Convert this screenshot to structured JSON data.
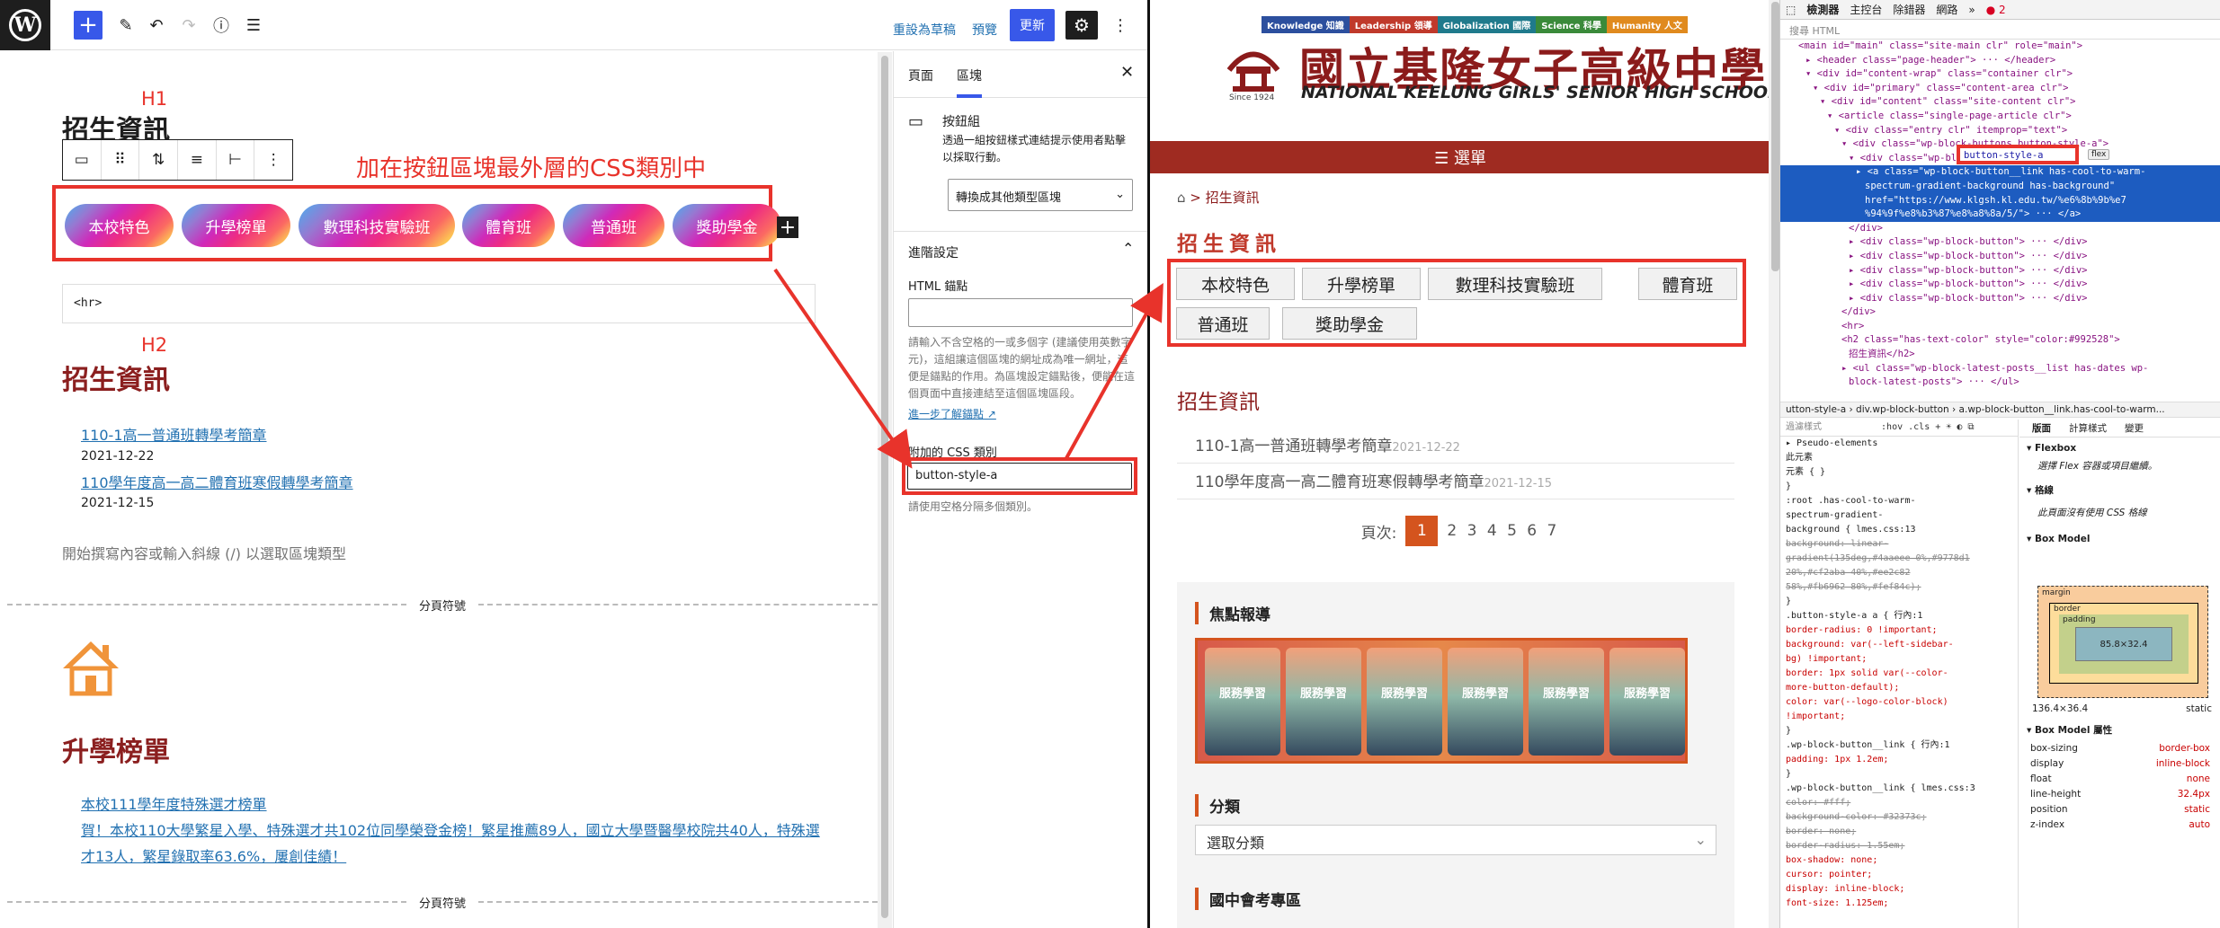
{
  "editor": {
    "topbar": {
      "save_draft": "重設為草稿",
      "preview": "預覽",
      "update": "更新"
    },
    "annotations": {
      "h1": "H1",
      "h2": "H2",
      "note": "加在按鈕區塊最外層的CSS類別中"
    },
    "content": {
      "heading1": "招生資訊",
      "buttons": [
        "本校特色",
        "升學榜單",
        "數理科技實驗班",
        "體育班",
        "普通班",
        "獎助學金"
      ],
      "hr_block": "<hr>",
      "heading2": "招生資訊",
      "posts": [
        {
          "title": "110-1高一普通班轉學考簡章",
          "date": "2021-12-22"
        },
        {
          "title": "110學年度高一高二體育班寒假轉學考簡章",
          "date": "2021-12-15"
        }
      ],
      "placeholder": "開始撰寫內容或輸入斜線 (/) 以選取區塊類型",
      "page_break": "分頁符號",
      "heading3": "升學榜單",
      "posts2": [
        {
          "title": "本校111學年度特殊選才榜單"
        },
        {
          "title": "賀！本校110大學繁星入學、特殊選才共102位同學榮登金榜！繁星推薦89人，國立大學暨醫學校院共40人，特殊選"
        },
        {
          "title": "才13人，繁星錄取率63.6%，屢創佳績！"
        }
      ]
    },
    "sidebar": {
      "tabs": [
        "頁面",
        "區塊"
      ],
      "block_name": "按鈕組",
      "block_desc": "透過一組按鈕樣式連結提示使用者點擊以採取行動。",
      "transform": "轉換成其他類型區塊",
      "advanced": "進階設定",
      "anchor_label": "HTML 錨點",
      "anchor_help": "請輸入不含空格的一或多個字 (建議使用英數字元)，這組讓這個區塊的網址成為唯一網址，這便是錨點的作用。為區塊設定錨點後，便能在這個頁面中直接連結至這個區塊區段。",
      "anchor_link": "進一步了解錨點",
      "css_label": "附加的 CSS 類別",
      "css_value": "button-style-a",
      "css_help": "請使用空格分隔多個類別。"
    }
  },
  "site": {
    "tags": [
      {
        "label": "Knowledge 知識",
        "color": "#2c4f9e"
      },
      {
        "label": "Leadership 領導",
        "color": "#c0392b"
      },
      {
        "label": "Globalization 國際",
        "color": "#1f7a8c"
      },
      {
        "label": "Science 科學",
        "color": "#3a8a3a"
      },
      {
        "label": "Humanity 人文",
        "color": "#e08a1e"
      }
    ],
    "school_name": "國立基隆女子高級中學",
    "school_en": "NATIONAL KEELUNG GIRLS' SENIOR HIGH SCHOOL",
    "since": "Since 1924",
    "menu": "☰ 選單",
    "breadcrumb_current": "招生資訊",
    "title": "招生資訊",
    "buttons": [
      "本校特色",
      "升學榜單",
      "數理科技實驗班",
      "體育班",
      "普通班",
      "獎助學金"
    ],
    "section_title": "招生資訊",
    "posts": [
      {
        "title": "110-1高一普通班轉學考簡章",
        "date": "2021-12-22"
      },
      {
        "title": "110學年度高一高二體育班寒假轉學考簡章",
        "date": "2021-12-15"
      }
    ],
    "pager_label": "頁次:",
    "pager_current": "1",
    "pager_pages": "2 3 4 5 6 7",
    "focus_title": "焦點報導",
    "banner_text": "服務學習",
    "category_title": "分類",
    "category_select": "選取分類",
    "exam_title": "國中會考專區"
  },
  "devtools": {
    "tabs": [
      "檢測器",
      "主控台",
      "除錯器",
      "網路"
    ],
    "filter": "搜尋 HTML",
    "highlight_class": "button-style-a",
    "badge": "flex",
    "errors": "2",
    "dom": [
      "<main id=\"main\" class=\"site-main clr\" role=\"main\">",
      "▸ <header class=\"page-header\"> ··· </header>",
      "▾ <div id=\"content-wrap\" class=\"container clr\">",
      "▾ <div id=\"primary\" class=\"content-area clr\">",
      "▾ <div id=\"content\" class=\"site-content clr\">",
      "▾ <article class=\"single-page-article clr\">",
      "▾ <div class=\"entry clr\" itemprop=\"text\">",
      "▾ <div class=\"wp-block-buttons button-style-a\">",
      "▾ <div class=\"wp-block-button\">",
      "▸ <a class=\"wp-block-button__link has-cool-to-warm-",
      "spectrum-gradient-background has-background\"",
      "href=\"https://www.klgsh.kl.edu.tw/%e6%8b%9b%e7",
      "%94%9f%e8%b3%87%e8%a8%8a/5/\"> ··· </a>",
      "</div>",
      "▸ <div class=\"wp-block-button\"> ··· </div>",
      "▸ <div class=\"wp-block-button\"> ··· </div>",
      "▸ <div class=\"wp-block-button\"> ··· </div>",
      "▸ <div class=\"wp-block-button\"> ··· </div>",
      "▸ <div class=\"wp-block-button\"> ··· </div>",
      "</div>",
      "<hr>",
      "<h2 class=\"has-text-color\" style=\"color:#992528\">",
      "招生資訊</h2>",
      "▸ <ul class=\"wp-block-latest-posts__list has-dates wp-",
      "block-latest-posts\"> ··· </ul>"
    ],
    "breadcrumb": "utton-style-a  ›  div.wp-block-button  ›  a.wp-block-button__link.has-cool-to-warm...",
    "styles_filter": "過濾樣式",
    "styles": [
      "▸ Pseudo-elements",
      "此元素",
      "元素 { }",
      "}",
      ":root .has-cool-to-warm-",
      "spectrum-gradient-",
      "background {    lmes.css:13",
      "  background: linear-",
      "  gradient(135deg,#4aaeee 0%,#9778d1",
      "  20%,#cf2aba 40%,#ee2c82",
      "  58%,#fb6962 80%,#fef84c);",
      "}",
      ".button-style-a a {    行內:1",
      "  border-radius: 0 !important;",
      "  background: var(--left-sidebar-",
      "  bg) !important;",
      "  border: 1px solid var(--color-",
      "  more-button-default);",
      "  color: var(--logo-color-block)",
      "  !important;",
      "}",
      ".wp-block-button__link {    行內:1",
      "  padding: 1px 1.2em;",
      "}",
      ".wp-block-button__link {    lmes.css:3",
      "  color: #fff;",
      "  background-color: #32373c;",
      "  border: none;",
      "  border-radius: 1.55em;",
      "  box-shadow: none;",
      "  cursor: pointer;",
      "  display: inline-block;",
      "  font-size: 1.125em;"
    ],
    "layout_tabs": [
      "版面",
      "計算樣式",
      "變更"
    ],
    "flexbox": "Flexbox",
    "flexbox_note": "選擇 Flex 容器或項目繼續。",
    "grid": "格線",
    "grid_note": "此頁面沒有使用 CSS 格線",
    "boxmodel": "Box Model",
    "box_size": "85.8×32.4",
    "box_total": "136.4×36.4",
    "box_pos": "static",
    "props_title": "Box Model 屬性",
    "props": [
      [
        "box-sizing",
        "border-box"
      ],
      [
        "display",
        "inline-block"
      ],
      [
        "float",
        "none"
      ],
      [
        "line-height",
        "32.4px"
      ],
      [
        "position",
        "static"
      ],
      [
        "z-index",
        "auto"
      ]
    ]
  }
}
